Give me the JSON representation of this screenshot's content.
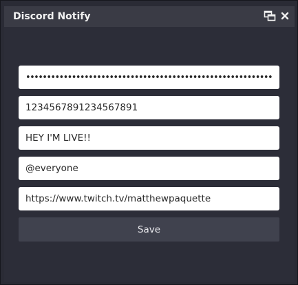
{
  "window": {
    "title": "Discord Notify",
    "popout_icon": "popout-window-icon",
    "close_icon": "close-icon"
  },
  "form": {
    "webhook_token": "••••••••••••••••••••••••••••••••••••••••••••••••••••••••••••••••",
    "channel_id": "1234567891234567891",
    "message": "HEY I'M LIVE!!",
    "mention": "@everyone",
    "stream_url": "https://www.twitch.tv/matthewpaquette"
  },
  "save_label": "Save"
}
